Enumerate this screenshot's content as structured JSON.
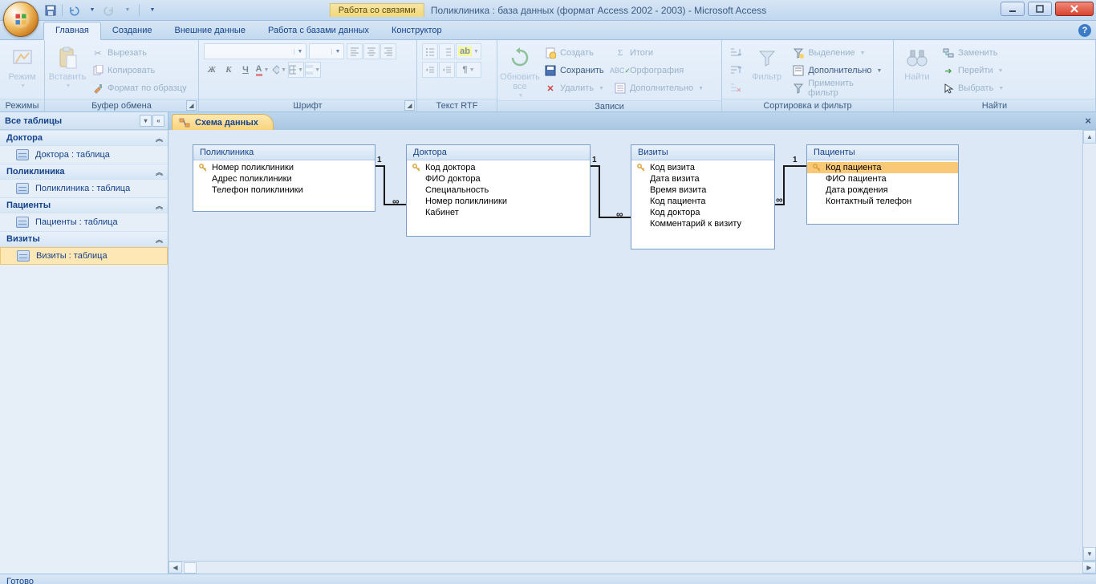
{
  "title": {
    "context_tab": "Работа со связями",
    "app_title": "Поликлиника : база данных (формат Access 2002 - 2003) - Microsoft Access"
  },
  "tabs": {
    "home": "Главная",
    "create": "Создание",
    "external": "Внешние данные",
    "dbtools": "Работа с базами данных",
    "design": "Конструктор"
  },
  "ribbon": {
    "modes_group": "Режимы",
    "mode": "Режим",
    "clipboard_group": "Буфер обмена",
    "paste": "Вставить",
    "cut": "Вырезать",
    "copy": "Копировать",
    "format_painter": "Формат по образцу",
    "font_group": "Шрифт",
    "richtext_group": "Текст RTF",
    "records_group": "Записи",
    "refresh": "Обновить все",
    "new": "Создать",
    "save": "Сохранить",
    "delete": "Удалить",
    "totals": "Итоги",
    "spelling": "Орфография",
    "more": "Дополнительно",
    "sortfilter_group": "Сортировка и фильтр",
    "filter": "Фильтр",
    "selection": "Выделение",
    "advanced": "Дополнительно",
    "toggle_filter": "Применить фильтр",
    "find_group": "Найти",
    "find": "Найти",
    "replace": "Заменить",
    "goto": "Перейти",
    "select": "Выбрать"
  },
  "nav": {
    "header": "Все таблицы",
    "groups": [
      {
        "name": "Доктора",
        "item": "Доктора : таблица"
      },
      {
        "name": "Поликлиника",
        "item": "Поликлиника : таблица"
      },
      {
        "name": "Пациенты",
        "item": "Пациенты : таблица"
      },
      {
        "name": "Визиты",
        "item": "Визиты : таблица"
      }
    ]
  },
  "doc_tab": "Схема данных",
  "tables": {
    "poly": {
      "title": "Поликлиника",
      "fields": [
        {
          "name": "Номер поликлиники",
          "key": true
        },
        {
          "name": "Адрес поликлиники",
          "key": false
        },
        {
          "name": "Телефон поликлиники",
          "key": false
        }
      ]
    },
    "doctors": {
      "title": "Доктора",
      "fields": [
        {
          "name": "Код доктора",
          "key": true
        },
        {
          "name": "ФИО доктора",
          "key": false
        },
        {
          "name": "Специальность",
          "key": false
        },
        {
          "name": "Номер поликлиники",
          "key": false
        },
        {
          "name": "Кабинет",
          "key": false
        }
      ]
    },
    "visits": {
      "title": "Визиты",
      "fields": [
        {
          "name": "Код визита",
          "key": true
        },
        {
          "name": "Дата визита",
          "key": false
        },
        {
          "name": "Время визита",
          "key": false
        },
        {
          "name": "Код пациента",
          "key": false
        },
        {
          "name": "Код доктора",
          "key": false
        },
        {
          "name": "Комментарий к визиту",
          "key": false
        }
      ]
    },
    "patients": {
      "title": "Пациенты",
      "fields": [
        {
          "name": "Код пациента",
          "key": true,
          "sel": true
        },
        {
          "name": "ФИО пациента",
          "key": false
        },
        {
          "name": "Дата рождения",
          "key": false
        },
        {
          "name": "Контактный телефон",
          "key": false
        }
      ]
    }
  },
  "status": "Готово"
}
